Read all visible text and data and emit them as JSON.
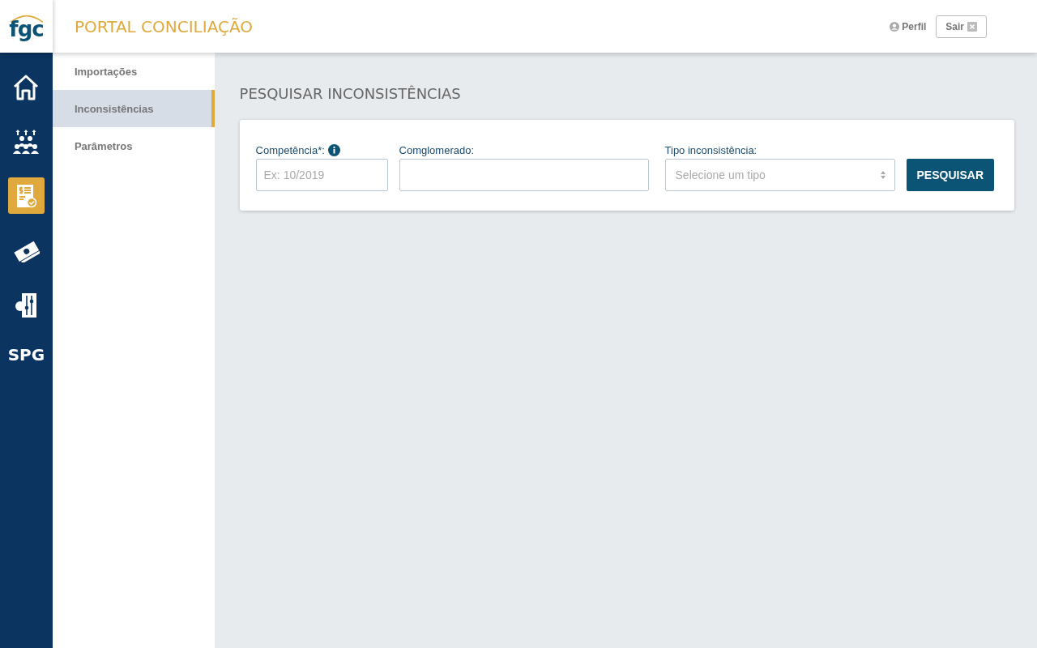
{
  "header": {
    "logo": "fgc",
    "title": "PORTAL CONCILIAÇÃO",
    "profile": "Perfil",
    "logout": "Sair"
  },
  "rail": [
    {
      "kind": "home",
      "selected": false
    },
    {
      "kind": "people",
      "selected": false
    },
    {
      "kind": "report",
      "selected": true
    },
    {
      "kind": "money",
      "selected": false
    },
    {
      "kind": "settings",
      "selected": false
    },
    {
      "kind": "text",
      "label": "SPG",
      "selected": false
    }
  ],
  "submenu": [
    {
      "label": "Importações",
      "selected": false
    },
    {
      "label": "Inconsistências",
      "selected": true
    },
    {
      "label": "Parâmetros",
      "selected": false
    }
  ],
  "page_title": "PESQUISAR INCONSISTÊNCIAS",
  "form": {
    "fields": [
      {
        "kind": "text",
        "label": "Competência*:",
        "info": true,
        "placeholder": "Ex: 10/2019"
      },
      {
        "kind": "text",
        "label": "Comglomerado:",
        "info": false
      },
      {
        "kind": "select",
        "label": "Tipo inconsistência:",
        "info": false,
        "placeholder": "Selecione um tipo"
      }
    ],
    "button": "PESQUISAR"
  }
}
